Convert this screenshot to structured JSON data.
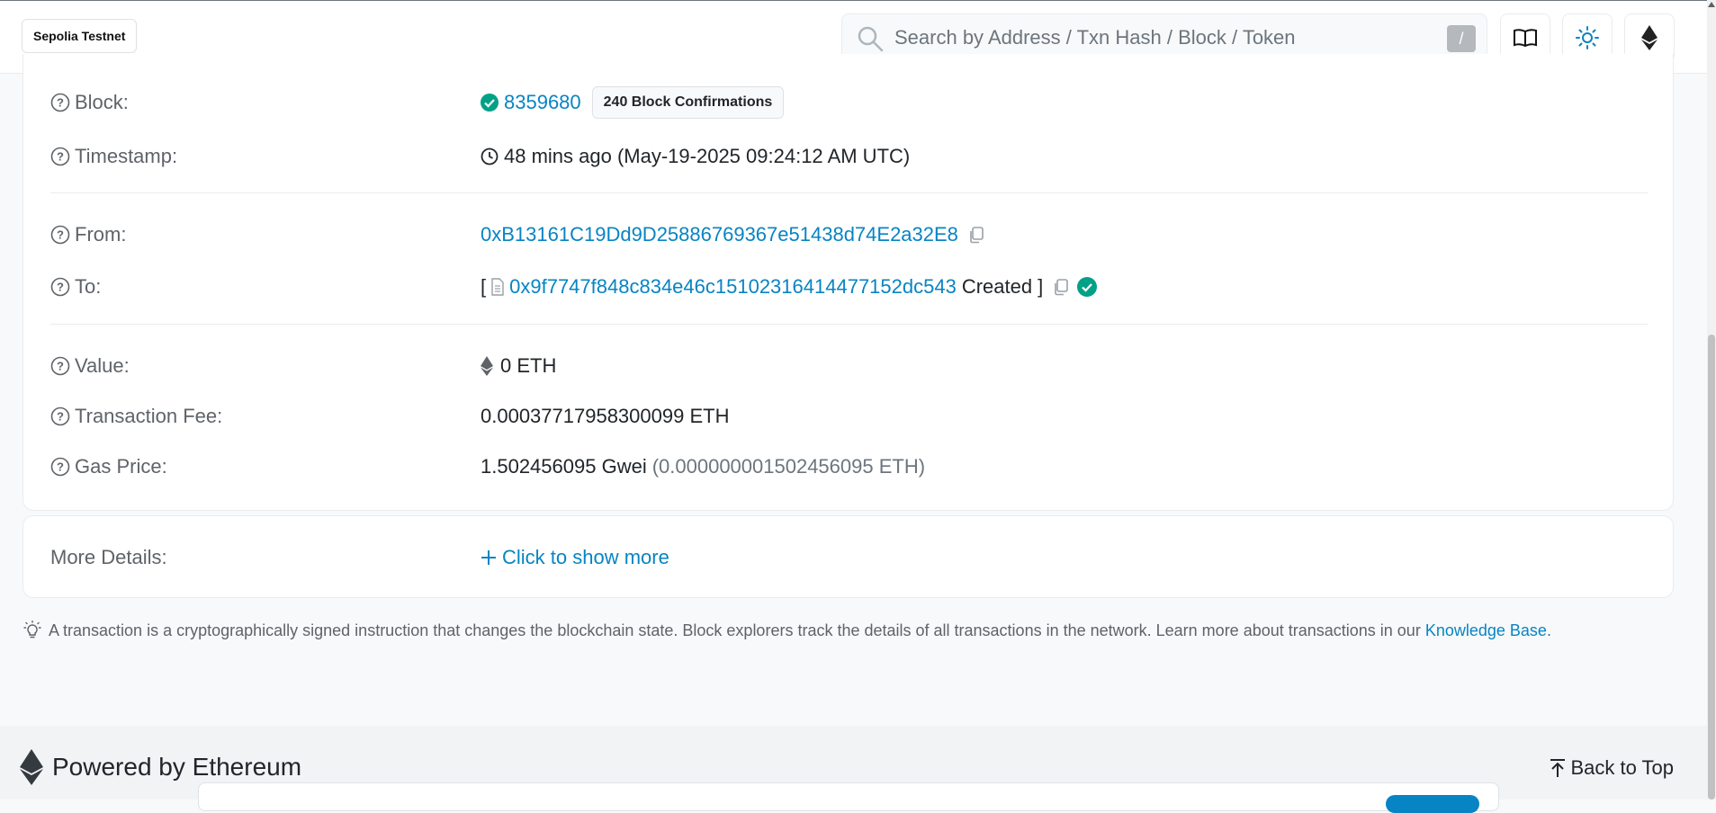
{
  "header": {
    "network_badge": "Sepolia Testnet",
    "search_placeholder": "Search by Address / Txn Hash / Block / Token",
    "search_shortcut": "/",
    "icons": [
      "book-icon",
      "sun-icon",
      "ethereum-icon"
    ]
  },
  "details": {
    "block": {
      "label": "Block:",
      "value": "8359680",
      "confirmations": "240 Block Confirmations"
    },
    "timestamp": {
      "label": "Timestamp:",
      "value": "48 mins ago (May-19-2025 09:24:12 AM UTC)"
    },
    "from": {
      "label": "From:",
      "value": "0xB13161C19Dd9D25886769367e51438d74E2a32E8"
    },
    "to": {
      "label": "To:",
      "bracket_open": "[",
      "value": "0x9f7747f848c834e46c15102316414477152dc543",
      "suffix": "Created",
      "bracket_close": "]"
    },
    "value": {
      "label": "Value:",
      "value": "0 ETH"
    },
    "fee": {
      "label": "Transaction Fee:",
      "value": "0.00037717958300099 ETH"
    },
    "gas_price": {
      "label": "Gas Price:",
      "value": "1.502456095 Gwei",
      "secondary": "(0.000000001502456095 ETH)"
    }
  },
  "more_details": {
    "label": "More Details:",
    "action": "Click to show more"
  },
  "note": {
    "text": "A transaction is a cryptographically signed instruction that changes the blockchain state. Block explorers track the details of all transactions in the network. Learn more about transactions in our ",
    "link": "Knowledge Base",
    "end": "."
  },
  "footer": {
    "powered": "Powered by Ethereum",
    "back_to_top": "Back to Top"
  },
  "colors": {
    "link": "#0784c3",
    "success": "#00a186",
    "label": "#5f6368"
  }
}
